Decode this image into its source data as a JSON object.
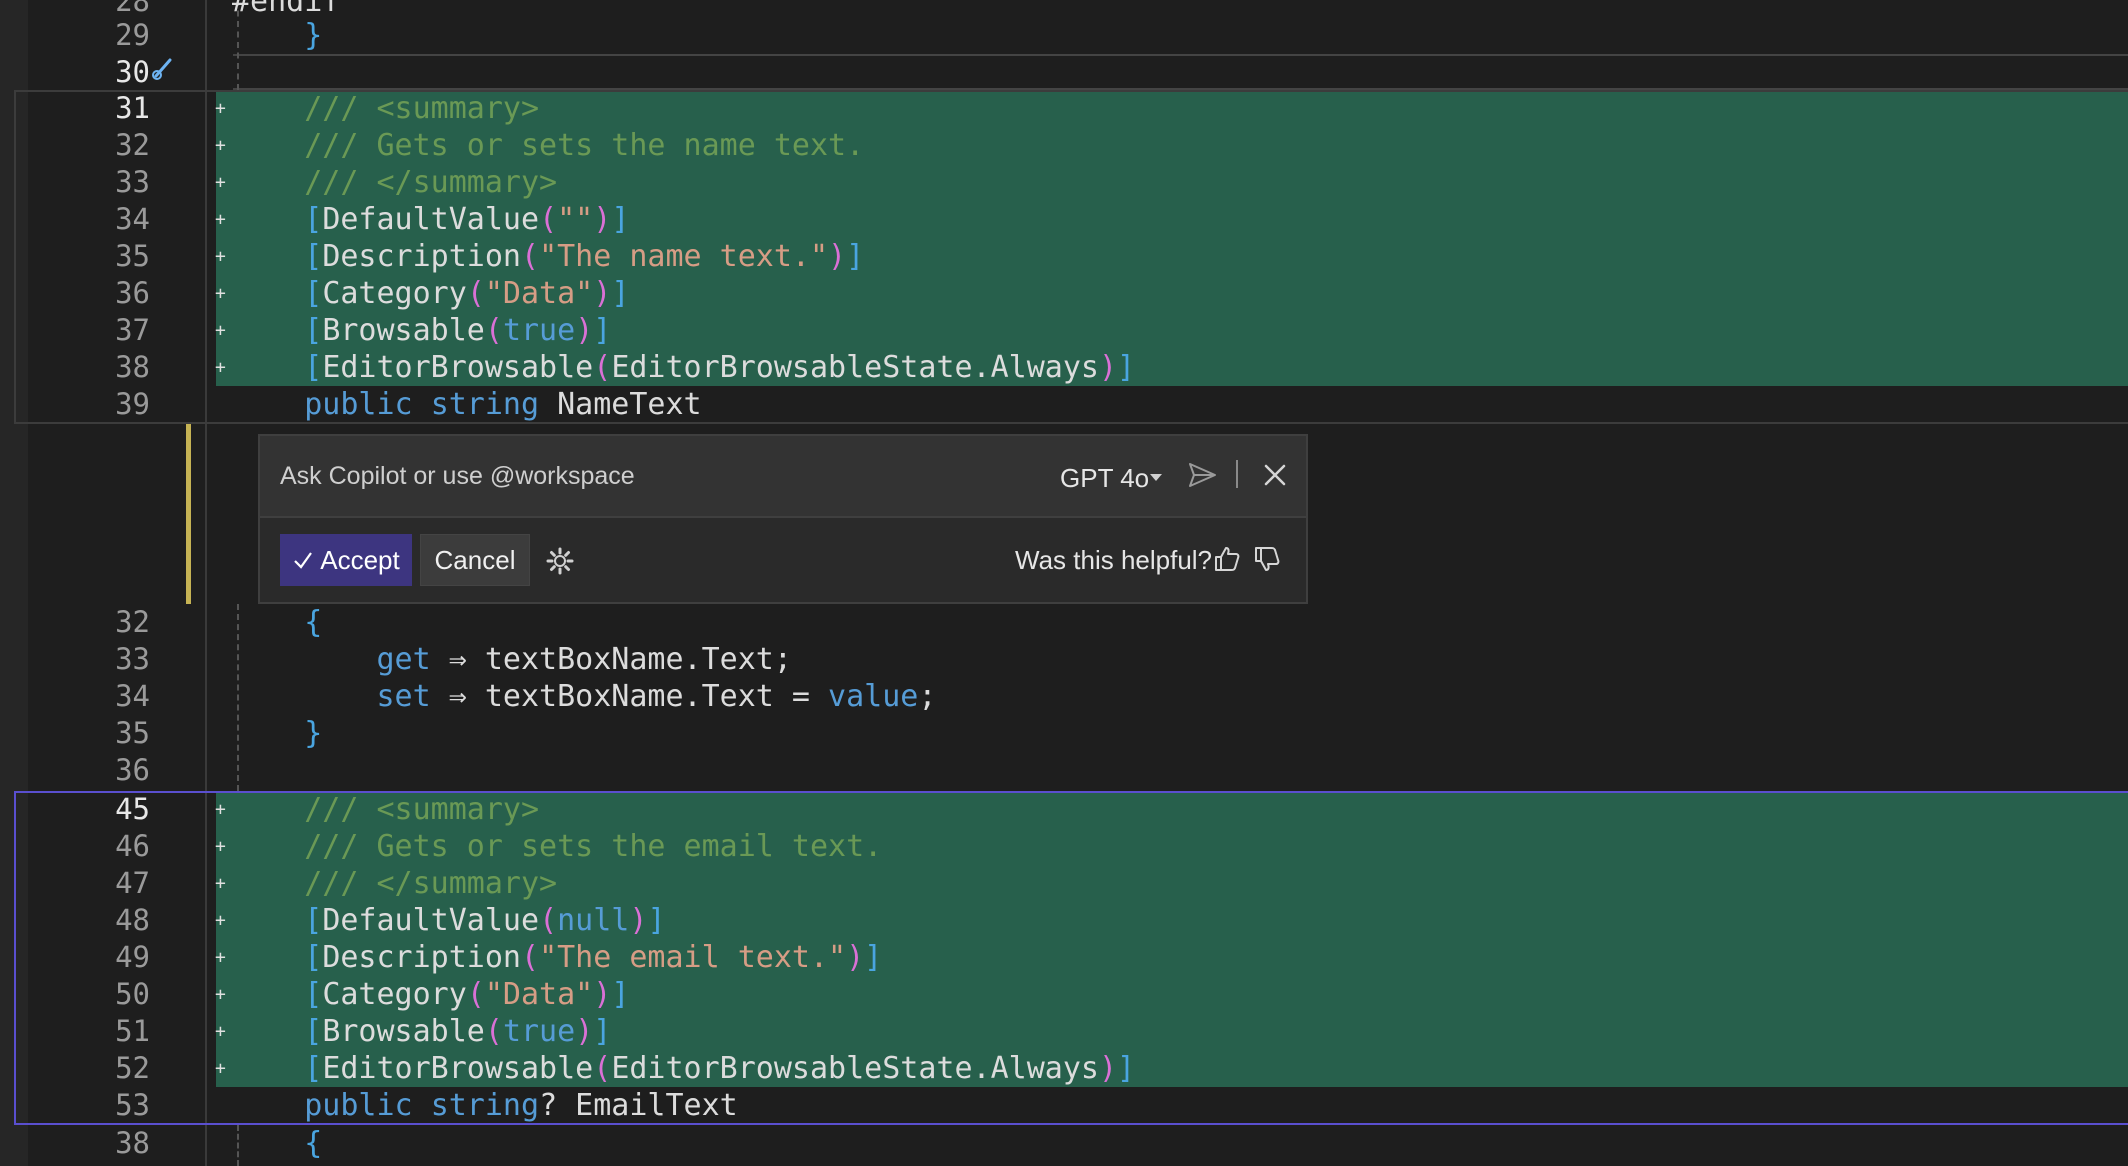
{
  "editor": {
    "lines": [
      {
        "num": "28",
        "kind": "plain",
        "tokens": [
          {
            "t": "#endif",
            "c": "id"
          }
        ]
      },
      {
        "num": "29",
        "kind": "plain",
        "tokens": [
          {
            "t": "    }",
            "c": "br-blue"
          }
        ]
      },
      {
        "num": "30",
        "kind": "plain",
        "tokens": []
      },
      {
        "num": "31",
        "kind": "added",
        "tokens": [
          {
            "t": "    /// <summary>",
            "c": "cmt"
          }
        ]
      },
      {
        "num": "32",
        "kind": "added",
        "tokens": [
          {
            "t": "    /// Gets or sets the name text.",
            "c": "cmt"
          }
        ]
      },
      {
        "num": "33",
        "kind": "added",
        "tokens": [
          {
            "t": "    /// </summary>",
            "c": "cmt"
          }
        ]
      },
      {
        "num": "34",
        "kind": "added",
        "tokens": [
          {
            "t": "    [",
            "c": "br-blue"
          },
          {
            "t": "DefaultValue",
            "c": "id"
          },
          {
            "t": "(",
            "c": "br-pink"
          },
          {
            "t": "\"\"",
            "c": "str"
          },
          {
            "t": ")",
            "c": "br-pink"
          },
          {
            "t": "]",
            "c": "br-blue"
          }
        ]
      },
      {
        "num": "35",
        "kind": "added",
        "tokens": [
          {
            "t": "    [",
            "c": "br-blue"
          },
          {
            "t": "Description",
            "c": "id"
          },
          {
            "t": "(",
            "c": "br-pink"
          },
          {
            "t": "\"The name text.\"",
            "c": "str"
          },
          {
            "t": ")",
            "c": "br-pink"
          },
          {
            "t": "]",
            "c": "br-blue"
          }
        ]
      },
      {
        "num": "36",
        "kind": "added",
        "tokens": [
          {
            "t": "    [",
            "c": "br-blue"
          },
          {
            "t": "Category",
            "c": "id"
          },
          {
            "t": "(",
            "c": "br-pink"
          },
          {
            "t": "\"Data\"",
            "c": "str"
          },
          {
            "t": ")",
            "c": "br-pink"
          },
          {
            "t": "]",
            "c": "br-blue"
          }
        ]
      },
      {
        "num": "37",
        "kind": "added",
        "tokens": [
          {
            "t": "    [",
            "c": "br-blue"
          },
          {
            "t": "Browsable",
            "c": "id"
          },
          {
            "t": "(",
            "c": "br-pink"
          },
          {
            "t": "true",
            "c": "kw"
          },
          {
            "t": ")",
            "c": "br-pink"
          },
          {
            "t": "]",
            "c": "br-blue"
          }
        ]
      },
      {
        "num": "38",
        "kind": "added",
        "tokens": [
          {
            "t": "    [",
            "c": "br-blue"
          },
          {
            "t": "EditorBrowsable",
            "c": "id"
          },
          {
            "t": "(",
            "c": "br-pink"
          },
          {
            "t": "EditorBrowsableState.Always",
            "c": "id"
          },
          {
            "t": ")",
            "c": "br-pink"
          },
          {
            "t": "]",
            "c": "br-blue"
          }
        ]
      },
      {
        "num": "39",
        "kind": "plain",
        "tokens": [
          {
            "t": "    public ",
            "c": "kw"
          },
          {
            "t": "string ",
            "c": "kw"
          },
          {
            "t": "NameText",
            "c": "id"
          }
        ]
      },
      {
        "num": "32",
        "kind": "plain",
        "tokens": [
          {
            "t": "    {",
            "c": "br-blue"
          }
        ]
      },
      {
        "num": "33",
        "kind": "plain",
        "tokens": [
          {
            "t": "        get ",
            "c": "kw"
          },
          {
            "t": "⇒ textBoxName.Text;",
            "c": "id"
          }
        ]
      },
      {
        "num": "34",
        "kind": "plain",
        "tokens": [
          {
            "t": "        set ",
            "c": "kw"
          },
          {
            "t": "⇒ textBoxName.Text = ",
            "c": "id"
          },
          {
            "t": "value",
            "c": "kw"
          },
          {
            "t": ";",
            "c": "id"
          }
        ]
      },
      {
        "num": "35",
        "kind": "plain",
        "tokens": [
          {
            "t": "    }",
            "c": "br-blue"
          }
        ]
      },
      {
        "num": "36",
        "kind": "plain",
        "tokens": []
      },
      {
        "num": "45",
        "kind": "added",
        "tokens": [
          {
            "t": "    /// <summary>",
            "c": "cmt"
          }
        ]
      },
      {
        "num": "46",
        "kind": "added",
        "tokens": [
          {
            "t": "    /// Gets or sets the email text.",
            "c": "cmt"
          }
        ]
      },
      {
        "num": "47",
        "kind": "added",
        "tokens": [
          {
            "t": "    /// </summary>",
            "c": "cmt"
          }
        ]
      },
      {
        "num": "48",
        "kind": "added",
        "tokens": [
          {
            "t": "    [",
            "c": "br-blue"
          },
          {
            "t": "DefaultValue",
            "c": "id"
          },
          {
            "t": "(",
            "c": "br-pink"
          },
          {
            "t": "null",
            "c": "kw"
          },
          {
            "t": ")",
            "c": "br-pink"
          },
          {
            "t": "]",
            "c": "br-blue"
          }
        ]
      },
      {
        "num": "49",
        "kind": "added",
        "tokens": [
          {
            "t": "    [",
            "c": "br-blue"
          },
          {
            "t": "Description",
            "c": "id"
          },
          {
            "t": "(",
            "c": "br-pink"
          },
          {
            "t": "\"The email text.\"",
            "c": "str"
          },
          {
            "t": ")",
            "c": "br-pink"
          },
          {
            "t": "]",
            "c": "br-blue"
          }
        ]
      },
      {
        "num": "50",
        "kind": "added",
        "tokens": [
          {
            "t": "    [",
            "c": "br-blue"
          },
          {
            "t": "Category",
            "c": "id"
          },
          {
            "t": "(",
            "c": "br-pink"
          },
          {
            "t": "\"Data\"",
            "c": "str"
          },
          {
            "t": ")",
            "c": "br-pink"
          },
          {
            "t": "]",
            "c": "br-blue"
          }
        ]
      },
      {
        "num": "51",
        "kind": "added",
        "tokens": [
          {
            "t": "    [",
            "c": "br-blue"
          },
          {
            "t": "Browsable",
            "c": "id"
          },
          {
            "t": "(",
            "c": "br-pink"
          },
          {
            "t": "true",
            "c": "kw"
          },
          {
            "t": ")",
            "c": "br-pink"
          },
          {
            "t": "]",
            "c": "br-blue"
          }
        ]
      },
      {
        "num": "52",
        "kind": "added",
        "tokens": [
          {
            "t": "    [",
            "c": "br-blue"
          },
          {
            "t": "EditorBrowsable",
            "c": "id"
          },
          {
            "t": "(",
            "c": "br-pink"
          },
          {
            "t": "EditorBrowsableState.Always",
            "c": "id"
          },
          {
            "t": ")",
            "c": "br-pink"
          },
          {
            "t": "]",
            "c": "br-blue"
          }
        ]
      },
      {
        "num": "53",
        "kind": "plain",
        "tokens": [
          {
            "t": "    public ",
            "c": "kw"
          },
          {
            "t": "string",
            "c": "kw"
          },
          {
            "t": "? EmailText",
            "c": "id"
          }
        ]
      },
      {
        "num": "38",
        "kind": "plain",
        "tokens": [
          {
            "t": "    {",
            "c": "br-blue"
          }
        ]
      }
    ]
  },
  "copilot": {
    "prompt_placeholder": "Ask Copilot or use @workspace",
    "model": "GPT 4o",
    "accept_label": "Accept",
    "cancel_label": "Cancel",
    "helpful_text": "Was this helpful?"
  },
  "colors": {
    "added_bg": "#27604c",
    "accept_bg": "#3d3580",
    "frame_selected": "#5a4fcf"
  }
}
